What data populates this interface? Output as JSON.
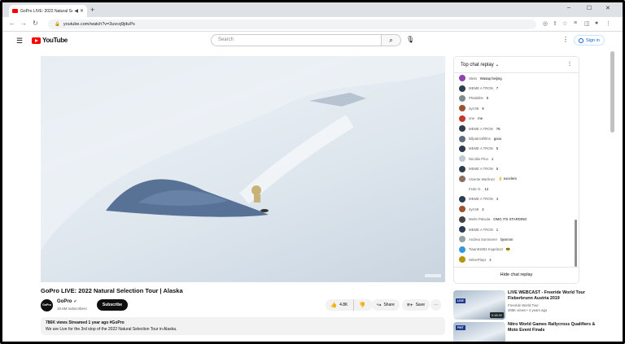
{
  "browser": {
    "tab_title": "GoPro LIVE: 2022 Natural Se",
    "url": "youtube.com/watch?v=3uvcq9jduPs",
    "new_tab": "+",
    "win_min": "–",
    "win_max": "☐",
    "win_close": "✕"
  },
  "masthead": {
    "logo_text": "YouTube",
    "search_placeholder": "Search",
    "signin_label": "Sign in"
  },
  "video": {
    "title": "GoPro LIVE: 2022 Natural Selection Tour | Alaska",
    "channel": "GoPro",
    "subscribers": "10.6M subscribers",
    "subscribe_label": "Subscribe",
    "likes": "4.8K",
    "share_label": "Share",
    "save_label": "Save",
    "views_line": "786K views  Streamed 1 year ago  #GoPro",
    "description": "We are Live for the 3rd stop of the 2022 Natural Selection Tour in Alaska."
  },
  "chat": {
    "header": "Top chat replay",
    "footer": "Hide chat replay",
    "messages": [
      {
        "author": "Stela",
        "text": "Wasap beijing",
        "color": "#8e44ad"
      },
      {
        "author": "MEME A TRON",
        "text": "7",
        "color": "#2c3e50"
      },
      {
        "author": "Phatitshe",
        "text": "5",
        "color": "#7f8c8d"
      },
      {
        "author": "4yrr49",
        "text": "9",
        "color": "#a0522d"
      },
      {
        "author": "one",
        "text": "me",
        "color": "#c0392b"
      },
      {
        "author": "MEME A TRON",
        "text": "76",
        "color": "#2c3e50"
      },
      {
        "author": "billpatrickfilms",
        "text": "gooo",
        "color": "#5d6d7e"
      },
      {
        "author": "MEME A TRON",
        "text": "5",
        "color": "#2c3e50"
      },
      {
        "author": "Nicolás Pino",
        "text": "1",
        "color": "#bfc9d1"
      },
      {
        "author": "MEME A TRON",
        "text": "5",
        "color": "#2c3e50"
      },
      {
        "author": "Vicente Martínez",
        "text": "👌 excelent",
        "color": "#8d6e63"
      },
      {
        "author": "Fede G.",
        "text": "12",
        "color": "#ffffff"
      },
      {
        "author": "MEME A TRON",
        "text": "4",
        "color": "#2c3e50"
      },
      {
        "author": "4yrr49",
        "text": "2",
        "color": "#a0522d"
      },
      {
        "author": "Merle Paloula",
        "text": "OMG ITS STARDING",
        "color": "#444444"
      },
      {
        "author": "MEME A TRON",
        "text": "1",
        "color": "#2c3e50"
      },
      {
        "author": "Andrea Sommerer",
        "text": "bjennnn",
        "color": "#95a5a6"
      },
      {
        "author": "Tiaan91853 Kogela13",
        "text": "😎",
        "color": "#3498db"
      },
      {
        "author": "SelvePlays",
        "text": "4",
        "color": "#b7950b"
      }
    ]
  },
  "recommended": [
    {
      "title": "LIVE WEBCAST - Freeride World Tour Fieberbrunn Austria 2019",
      "channel": "Freeride World Tour",
      "meta": "295K views • 4 years ago",
      "duration": "3:18:32",
      "badge": "LIVE"
    },
    {
      "title": "Nitro World Games Rallycross Qualifiers & Moto Event Finals",
      "channel": "",
      "meta": "",
      "duration": "",
      "badge": "FWT"
    }
  ],
  "icons": {
    "menu": "menu-icon",
    "search": "search-icon",
    "mic": "mic-icon",
    "like": "thumbs-up-icon",
    "dislike": "thumbs-down-icon",
    "share": "share-icon",
    "save": "save-icon"
  }
}
